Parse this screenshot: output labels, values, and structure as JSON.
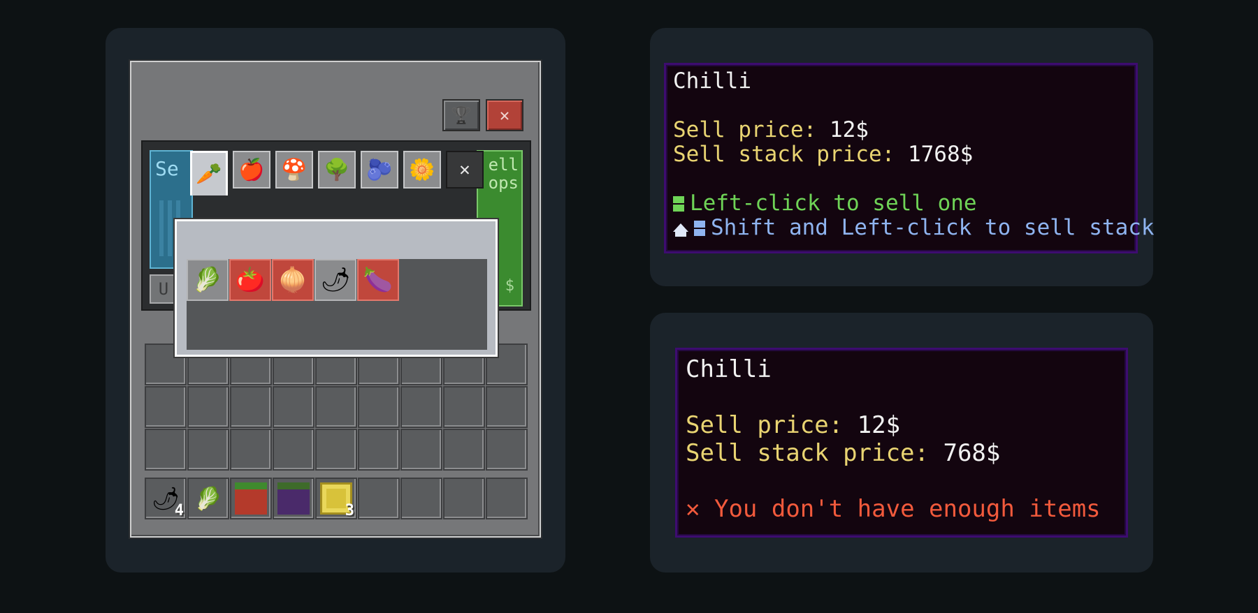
{
  "gui": {
    "tabs": [
      {
        "name": "carrot-tab",
        "icon": "🥕"
      },
      {
        "name": "apple-tab",
        "icon": "🍎"
      },
      {
        "name": "mushroom-tab",
        "icon": "🍄"
      },
      {
        "name": "tree-tab",
        "icon": "🌳"
      },
      {
        "name": "berry-bush-tab",
        "icon": "🫐"
      },
      {
        "name": "flower-tab",
        "icon": "🌼"
      }
    ],
    "close_tab_label": "✕",
    "close_button_label": "✕",
    "trophy_icon": "🏆",
    "bg_left_text": "Se",
    "bg_right_text": "ell\nops",
    "bg_right_dollar": "$",
    "bg_u_text": "U",
    "popup_items": [
      {
        "name": "cabbage",
        "icon": "🥬",
        "style": "gray"
      },
      {
        "name": "tomato",
        "icon": "🍅",
        "style": "red"
      },
      {
        "name": "onion",
        "icon": "🧅",
        "style": "red"
      },
      {
        "name": "chilli",
        "icon": "🌶",
        "style": "gray"
      },
      {
        "name": "eggplant",
        "icon": "🍆",
        "style": "red"
      }
    ],
    "hotbar": [
      {
        "name": "chilli",
        "icon": "🌶",
        "count": "4"
      },
      {
        "name": "cabbage",
        "icon": "🥬",
        "count": ""
      },
      {
        "name": "tomato-block",
        "icon": "",
        "count": ""
      },
      {
        "name": "eggplant-block",
        "icon": "",
        "count": ""
      },
      {
        "name": "yellow-block",
        "icon": "",
        "count": "3"
      }
    ]
  },
  "tooltip1": {
    "title": "Chilli",
    "sell_price_label": "Sell price: ",
    "sell_price_value": "12$",
    "stack_price_label": "Sell stack price: ",
    "stack_price_value": "1768$",
    "left_click_text": "Left-click to sell one",
    "shift_click_text": "Shift and Left-click to sell stack"
  },
  "tooltip2": {
    "title": "Chilli",
    "sell_price_label": "Sell price: ",
    "sell_price_value": "12$",
    "stack_price_label": "Sell stack price: ",
    "stack_price_value": "768$",
    "error_icon": "✕",
    "error_text": "You don't have enough items"
  },
  "colors": {
    "background": "#0d1214",
    "card": "#1b232a",
    "tooltip_bg": "#13050f",
    "tooltip_border": "#3d0c70",
    "price_label": "#e9d472",
    "green": "#6fd457",
    "blue": "#8fb4f0",
    "red": "#f25a3c"
  }
}
